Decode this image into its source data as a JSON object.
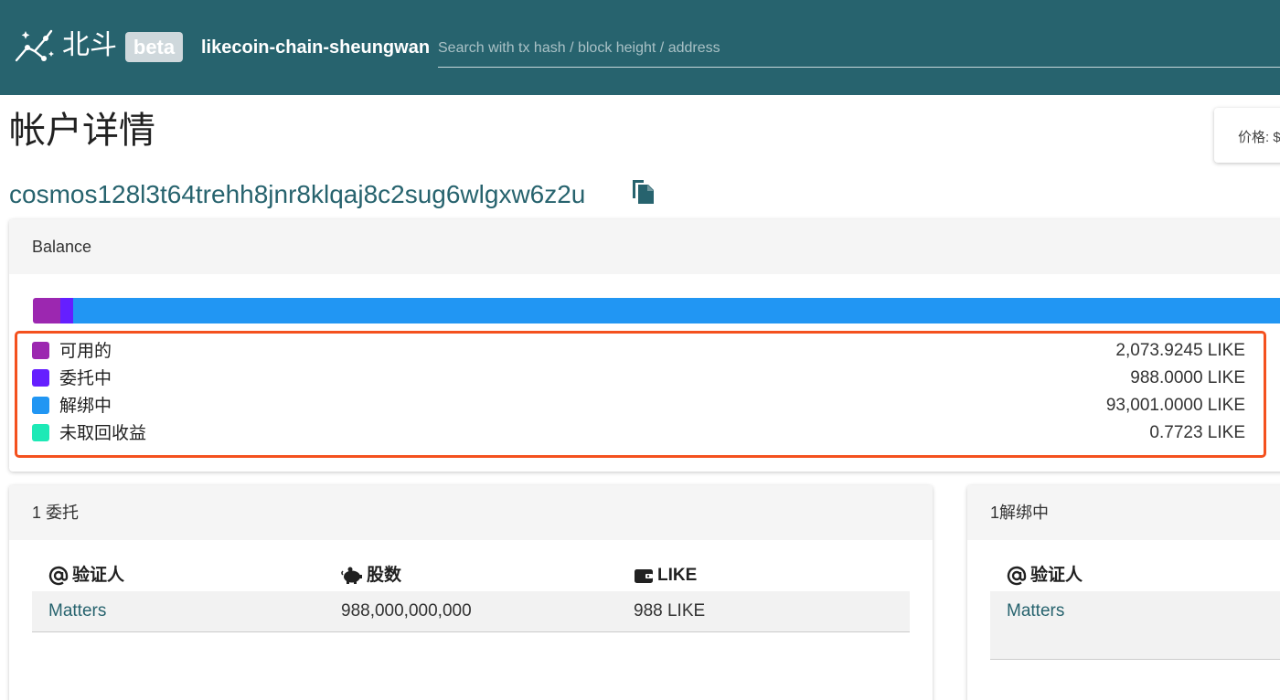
{
  "header": {
    "brand": "北斗",
    "badge": "beta",
    "chain_name": "likecoin-chain-sheungwan",
    "search_placeholder": "Search with tx hash / block height / address",
    "logo_icon": "constellation-icon"
  },
  "page": {
    "title": "帐户详情",
    "price_label": "价格: $",
    "address": "cosmos128l3t64trehh8jnr8klqaj8c2sug6wlgxw6z2u",
    "copy_icon": "copy-icon"
  },
  "balance": {
    "title": "Balance",
    "items": [
      {
        "label": "可用的",
        "value": "2,073.9245 LIKE",
        "amount": 2073.9245,
        "color": "#9c27b0"
      },
      {
        "label": "委托中",
        "value": "988.0000 LIKE",
        "amount": 988.0,
        "color": "#651fff"
      },
      {
        "label": "解绑中",
        "value": "93,001.0000 LIKE",
        "amount": 93001.0,
        "color": "#2196f3"
      },
      {
        "label": "未取回收益",
        "value": "0.7723 LIKE",
        "amount": 0.7723,
        "color": "#1de9b6"
      }
    ]
  },
  "delegations": {
    "title": "1 委托",
    "columns": [
      {
        "label": "验证人",
        "icon": "at-icon"
      },
      {
        "label": "股数",
        "icon": "piggy-bank-icon"
      },
      {
        "label": "LIKE",
        "icon": "wallet-icon"
      }
    ],
    "rows": [
      {
        "validator": "Matters",
        "shares": "988,000,000,000",
        "amount": "988 LIKE"
      }
    ]
  },
  "unbonding": {
    "title": "1解绑中",
    "columns": [
      {
        "label": "验证人",
        "icon": "at-icon"
      }
    ],
    "rows": [
      {
        "validator": "Matters"
      }
    ]
  }
}
